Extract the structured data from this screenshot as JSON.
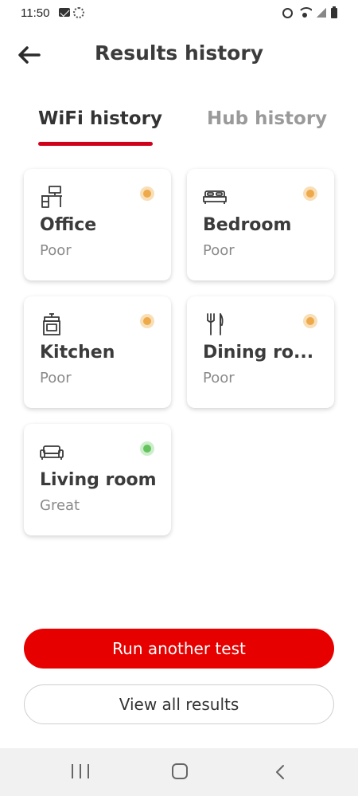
{
  "status_bar": {
    "time": "11:50",
    "icons": [
      "mail-icon",
      "sync-icon",
      "alarm-icon",
      "wifi-icon",
      "signal-icon",
      "battery-icon"
    ]
  },
  "header": {
    "title": "Results history",
    "back_icon": "back-arrow-icon"
  },
  "tabs": [
    {
      "label": "WiFi history",
      "selected": true
    },
    {
      "label": "Hub history",
      "selected": false
    }
  ],
  "rooms": [
    {
      "name": "Office",
      "status": "Poor",
      "icon": "desk-icon",
      "status_color": "#eea94a"
    },
    {
      "name": "Bedroom",
      "status": "Poor",
      "icon": "bed-icon",
      "status_color": "#eea94a"
    },
    {
      "name": "Kitchen",
      "status": "Poor",
      "icon": "oven-icon",
      "status_color": "#eea94a"
    },
    {
      "name": "Dining ro...",
      "status": "Poor",
      "icon": "cutlery-icon",
      "status_color": "#eea94a"
    },
    {
      "name": "Living room",
      "status": "Great",
      "icon": "sofa-icon",
      "status_color": "#65c35e"
    }
  ],
  "actions": {
    "run_label": "Run another test",
    "view_label": "View all results"
  },
  "colors": {
    "accent": "#e60000",
    "tab_indicator": "#d0021b",
    "poor": "#eea94a",
    "great": "#65c35e"
  },
  "nav_bar": {
    "icons": [
      "recents-icon",
      "home-icon",
      "back-icon"
    ]
  }
}
